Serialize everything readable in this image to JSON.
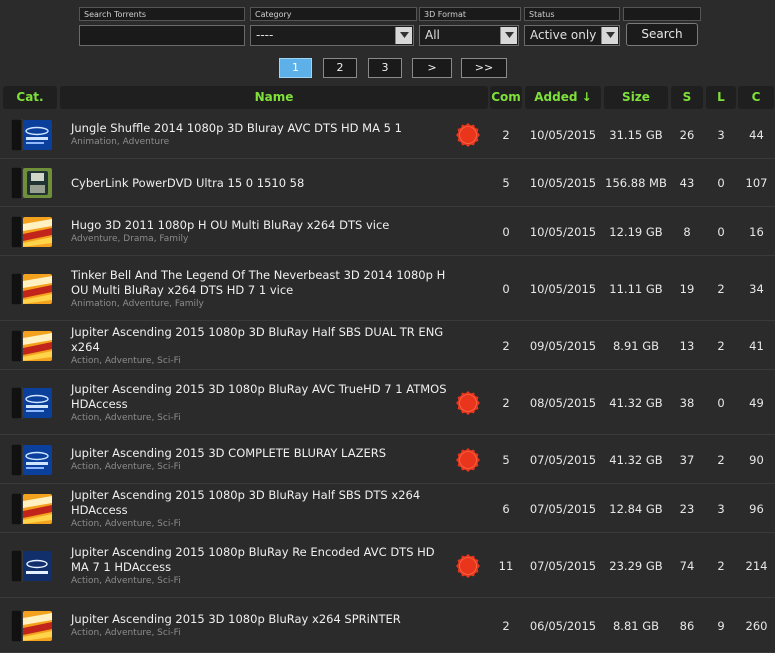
{
  "filters": {
    "search_label": "Search Torrents",
    "search_value": "",
    "category_label": "Category",
    "category_value": "----",
    "format_label": "3D Format",
    "format_value": "All",
    "status_label": "Status",
    "status_value": "Active only",
    "search_button": "Search"
  },
  "pager": {
    "pages": [
      "1",
      "2",
      "3"
    ],
    "next": ">",
    "last": ">>",
    "current": "1"
  },
  "table": {
    "headers": {
      "cat": "Cat.",
      "name": "Name",
      "com": "Com",
      "added": "Added",
      "added_sort": "↓",
      "size": "Size",
      "s": "S",
      "l": "L",
      "c": "C"
    },
    "rows": [
      {
        "cat_label": "Blu Ray",
        "cat_icon": "bluray-icon",
        "title": "Jungle Shuffle 2014 1080p 3D Bluray AVC DTS HD MA 5 1",
        "genres": "Animation, Adventure",
        "badge": "50% OFF",
        "com": "2",
        "added": "10/05/2015",
        "size": "31.15 GB",
        "s": "26",
        "l": "3",
        "c": "44"
      },
      {
        "cat_label": "PC ISO",
        "cat_icon": "pc-iso-icon",
        "title": "CyberLink PowerDVD Ultra 15 0 1510 58",
        "genres": "",
        "badge": "",
        "com": "5",
        "added": "10/05/2015",
        "size": "156.88 MB",
        "s": "43",
        "l": "0",
        "c": "107"
      },
      {
        "cat_label": "x264",
        "cat_icon": "x264-icon",
        "title": "Hugo 3D 2011 1080p H OU Multi BluRay x264 DTS vice",
        "genres": "Adventure, Drama, Family",
        "badge": "",
        "com": "0",
        "added": "10/05/2015",
        "size": "12.19 GB",
        "s": "8",
        "l": "0",
        "c": "16"
      },
      {
        "cat_label": "x264",
        "cat_icon": "x264-icon",
        "title": "Tinker Bell And The Legend Of The Neverbeast 3D 2014 1080p H OU Multi BluRay x264 DTS HD 7 1 vice",
        "genres": "Animation, Adventure, Family",
        "badge": "",
        "com": "0",
        "added": "10/05/2015",
        "size": "11.11 GB",
        "s": "19",
        "l": "2",
        "c": "34"
      },
      {
        "cat_label": "x264",
        "cat_icon": "x264-icon",
        "title": "Jupiter Ascending 2015 1080p 3D BluRay Half SBS DUAL TR ENG x264",
        "genres": "Action, Adventure, Sci-Fi",
        "badge": "",
        "com": "2",
        "added": "09/05/2015",
        "size": "8.91 GB",
        "s": "13",
        "l": "2",
        "c": "41"
      },
      {
        "cat_label": "Blu Ray",
        "cat_icon": "bluray-icon",
        "title": "Jupiter Ascending 2015 3D 1080p BluRay AVC TrueHD 7 1 ATMOS HDAccess",
        "genres": "Action, Adventure, Sci-Fi",
        "badge": "50% OFF",
        "com": "2",
        "added": "08/05/2015",
        "size": "41.32 GB",
        "s": "38",
        "l": "0",
        "c": "49"
      },
      {
        "cat_label": "Blu Ray",
        "cat_icon": "bluray-icon",
        "title": "Jupiter Ascending 2015 3D COMPLETE BLURAY LAZERS",
        "genres": "Action, Adventure, Sci-Fi",
        "badge": "50% OFF",
        "com": "5",
        "added": "07/05/2015",
        "size": "41.32 GB",
        "s": "37",
        "l": "2",
        "c": "90"
      },
      {
        "cat_label": "x264",
        "cat_icon": "x264-icon",
        "title": "Jupiter Ascending 2015 1080p 3D BluRay Half SBS DTS x264 HDAccess",
        "genres": "Action, Adventure, Sci-Fi",
        "badge": "",
        "com": "6",
        "added": "07/05/2015",
        "size": "12.84 GB",
        "s": "23",
        "l": "3",
        "c": "96"
      },
      {
        "cat_label": "BD25",
        "cat_icon": "bd25-icon",
        "title": "Jupiter Ascending 2015 1080p BluRay Re Encoded AVC DTS HD MA 7 1 HDAccess",
        "genres": "Action, Adventure, Sci-Fi",
        "badge": "50% OFF",
        "com": "11",
        "added": "07/05/2015",
        "size": "23.29 GB",
        "s": "74",
        "l": "2",
        "c": "214"
      },
      {
        "cat_label": "x264",
        "cat_icon": "x264-icon",
        "title": "Jupiter Ascending 2015 3D 1080p BluRay x264 SPRiNTER",
        "genres": "Action, Adventure, Sci-Fi",
        "badge": "",
        "com": "2",
        "added": "06/05/2015",
        "size": "8.81 GB",
        "s": "86",
        "l": "9",
        "c": "260"
      }
    ]
  },
  "colors": {
    "background": "#2b2b2b",
    "header_text": "#7ee13a",
    "active_page": "#5db0e8",
    "badge": "#e8351c"
  }
}
